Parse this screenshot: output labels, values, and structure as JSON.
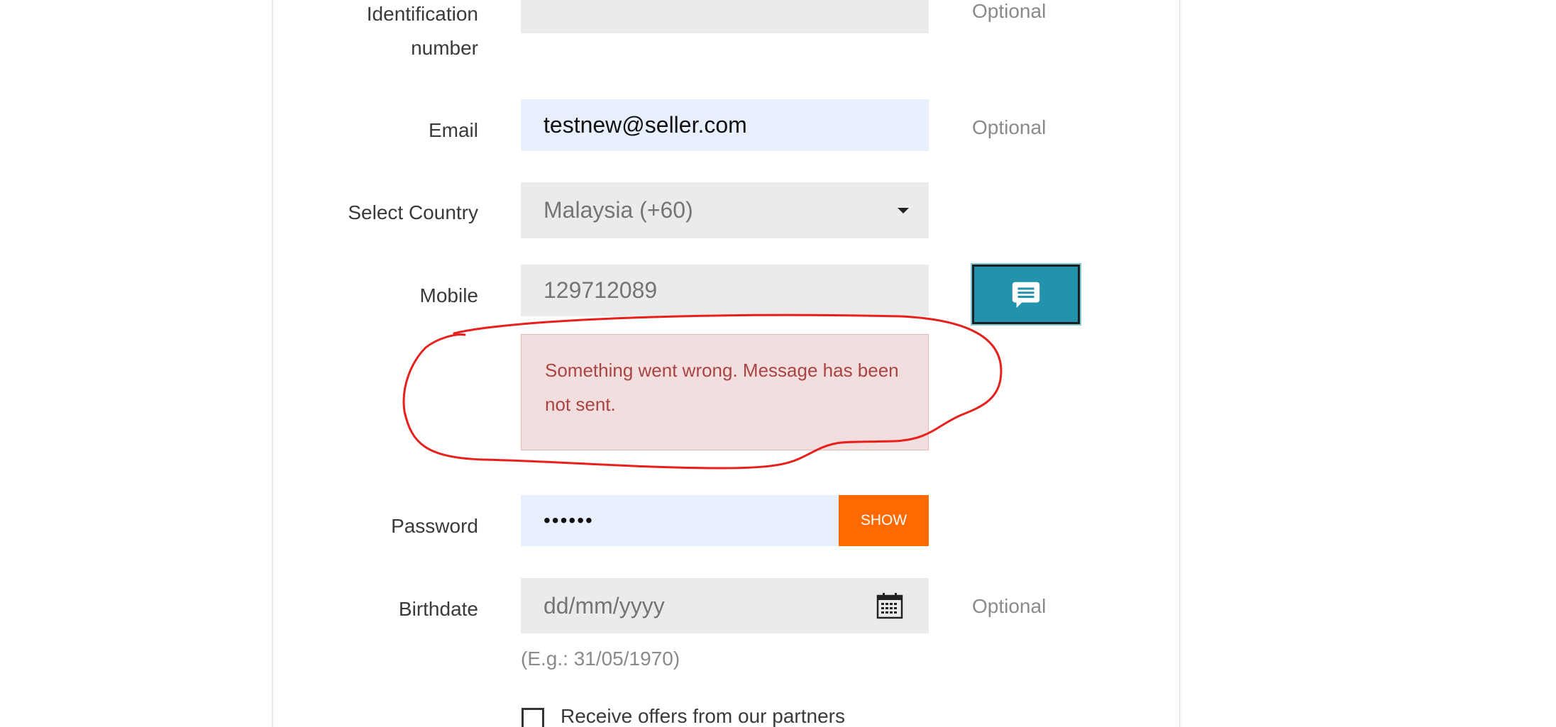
{
  "form": {
    "identification": {
      "label_line1": "Identification",
      "label_line2": "number",
      "value": "",
      "optional": "Optional"
    },
    "email": {
      "label": "Email",
      "value": "testnew@seller.com",
      "optional": "Optional"
    },
    "country": {
      "label": "Select Country",
      "selected": "Malaysia (+60)"
    },
    "mobile": {
      "label": "Mobile",
      "value": "129712089",
      "send_icon": "chat-message-icon"
    },
    "error": {
      "message": "Something went wrong. Message has been not sent."
    },
    "password": {
      "label": "Password",
      "masked_value": "••••••",
      "show_label": "SHOW"
    },
    "birthdate": {
      "label": "Birthdate",
      "placeholder": "dd/mm/yyyy",
      "optional": "Optional",
      "hint": "(E.g.: 31/05/1970)"
    },
    "partners": {
      "label": "Receive offers from our partners",
      "checked": false
    }
  },
  "colors": {
    "accent_orange": "#ff6a00",
    "sms_button": "#2393ad",
    "error_bg": "#f2dede",
    "error_text": "#a94442",
    "annotation_red": "#e8201c",
    "autofill_bg": "#e8f0fe",
    "field_bg": "#ebebeb"
  }
}
